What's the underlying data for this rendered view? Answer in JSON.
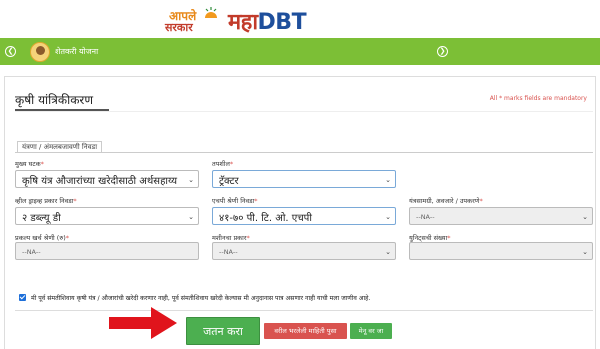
{
  "header": {
    "logo_aaple_line1": "आपले",
    "logo_aaple_line2": "सरकार",
    "logo_maha": "महा",
    "logo_dbt": "DBT"
  },
  "nav": {
    "tab_label": "शेतकरी योजना",
    "left_arrow_icon": "chevron-left-circle-icon",
    "right_arrow_icon": "chevron-right-circle-icon",
    "color": "#7cbf36"
  },
  "page": {
    "title": "कृषी यांत्रिकीकरण",
    "mandatory_note": "All * marks fields are mandatory",
    "section_tab": "यंत्रणा / अंमलबजावणी निवडा"
  },
  "form": {
    "main_component": {
      "label": "मुख्य घटक",
      "value": "कृषि यंत्र औजारांच्या खरेदीसाठी अर्थसहाय्य"
    },
    "details": {
      "label": "तपशील",
      "value": "ट्रॅक्टर"
    },
    "wheel_drive": {
      "label": "व्हील ड्राइव्ह प्रकार निवडा",
      "value": "२ डब्ल्यू डी"
    },
    "hp_category": {
      "label": "एचपी श्रेणी निवडा",
      "value": "४१-७० पी. टि. ओ. एचपी"
    },
    "equipment": {
      "label": "यंत्रसामग्री, अवजारे / उपकरणे",
      "value": "--NA--"
    },
    "cost_category": {
      "label": "प्रकल्प खर्च श्रेणी (रु)",
      "value": "--NA--"
    },
    "machine_type": {
      "label": "मशीनचा प्रकार",
      "value": "--NA--"
    },
    "unit_count": {
      "label": "युनिट्सची संख्या",
      "value": ""
    },
    "required_mark": "*"
  },
  "declaration": {
    "checked": true,
    "text": "मी पूर्व संमतीशिवाय कृषी यंत्र / औजारांची खरेदी करणार नाही, पूर्व संमतीशिवाय खरेदी केल्यास मी अनुदानास पात्र असणार नाही याची मला जाणीव आहे."
  },
  "buttons": {
    "save": "जतन करा",
    "previous": "वरील भरलेली माहिती पुसा",
    "menu": "मेनू वर जा"
  },
  "colors": {
    "green": "#4caf50",
    "red": "#d9534f",
    "annotation_arrow": "#e0141c"
  }
}
